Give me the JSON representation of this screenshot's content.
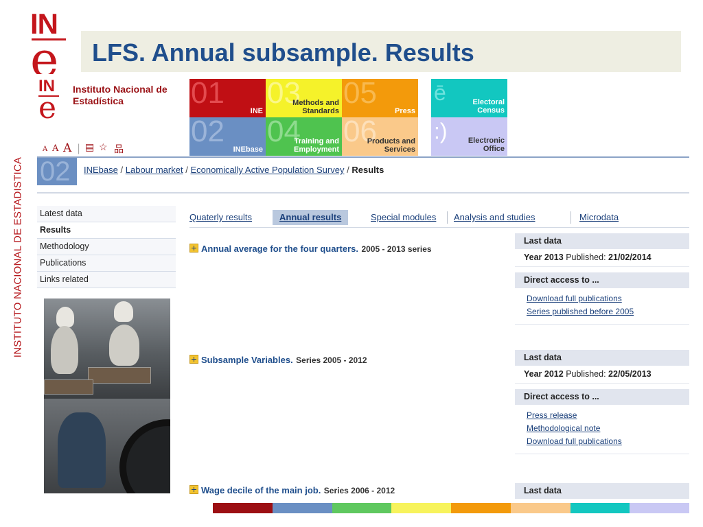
{
  "slide": {
    "title": "LFS.  Annual subsample. Results",
    "side_text": "INSTITUTO NACIONAL DE ESTADISTICA",
    "logo_in": "IN",
    "logo_e": "e"
  },
  "header": {
    "logo_in": "IN",
    "logo_e": "e",
    "logo_name": "Instituto Nacional de Estadística",
    "tools": {
      "font_small": "A",
      "font_medium": "A",
      "font_large": "A",
      "separator": "|",
      "print_icon": "▤",
      "favorite_icon": "☆",
      "sitemap_icon": "品"
    },
    "tiles": [
      {
        "num": "01",
        "label": "INE",
        "bg": "#c00f14",
        "num_color": "#e34b4f",
        "theme": "dark"
      },
      {
        "num": "03",
        "label": "Methods and Standards",
        "bg": "#f5f22a",
        "num_color": "#fbf888",
        "theme": "light"
      },
      {
        "num": "05",
        "label": "Press",
        "bg": "#f39a0b",
        "num_color": "#f8b94f",
        "theme": "dark"
      },
      {
        "num": "02",
        "label": "INEbase",
        "bg": "#6a8fc3",
        "num_color": "#9bb4d9",
        "theme": "dark"
      },
      {
        "num": "04",
        "label": "Training and Employment",
        "bg": "#4fc34f",
        "num_color": "#8fdb8f",
        "theme": "dark"
      },
      {
        "num": "06",
        "label": "Products and Services",
        "bg": "#fac98a",
        "num_color": "#fde0ba",
        "theme": "light"
      }
    ],
    "extras": [
      {
        "symbol": "ē",
        "label": "Electoral Census",
        "bg": "#12c7c0",
        "sym_color": "#6fe3de",
        "label_color": "#ffffff"
      },
      {
        "symbol": ":)",
        "label": "Electronic Office",
        "bg": "#c9c8f4",
        "sym_color": "#ffffff",
        "label_color": "#333333"
      }
    ]
  },
  "breadcrumb": {
    "section_num": "02",
    "items": [
      "INEbase",
      "Labour market",
      "Economically Active Population Survey"
    ],
    "separator": "/",
    "current": "Results"
  },
  "sidebar": {
    "items": [
      {
        "label": "Latest data",
        "active": false
      },
      {
        "label": "Results",
        "active": true
      },
      {
        "label": "Methodology",
        "active": false
      },
      {
        "label": "Publications",
        "active": false
      },
      {
        "label": "Links related",
        "active": false
      }
    ]
  },
  "tabs": [
    {
      "label": "Quaterly results",
      "active": false
    },
    {
      "label": "Annual results",
      "active": true
    },
    {
      "label": "Special modules",
      "active": false
    },
    {
      "label": "Analysis and studies",
      "active": false
    },
    {
      "label": "Microdata",
      "active": false
    }
  ],
  "sections": [
    {
      "title": "Annual average for the four quarters.",
      "subtitle": "2005 - 2013 series",
      "panel": {
        "last_data_header": "Last data",
        "year": "Year 2013",
        "published_label": "Published:",
        "published_date": "21/02/2014",
        "direct_header": "Direct access to ...",
        "links": [
          "Download full publications",
          "Series published before 2005"
        ]
      }
    },
    {
      "title": "Subsample Variables.",
      "subtitle": "Series 2005 - 2012",
      "panel": {
        "last_data_header": "Last data",
        "year": "Year 2012",
        "published_label": "Published:",
        "published_date": "22/05/2013",
        "direct_header": "Direct access to ...",
        "links": [
          "Press release",
          "Methodological note",
          "Download full publications"
        ]
      }
    },
    {
      "title": "Wage decile of the main job.",
      "subtitle": "Series 2006 - 2012",
      "panel": {
        "last_data_header": "Last data"
      }
    }
  ],
  "colors": {
    "brand_red": "#c4161c",
    "title_blue": "#1f4e8c",
    "link_blue": "#1a3f7a",
    "footer_stripes": [
      "#9c0f13",
      "#6a8fc3",
      "#5fc85f",
      "#f7f35c",
      "#f39a0b",
      "#fac98a",
      "#12c7c0",
      "#c9c8f4"
    ]
  }
}
